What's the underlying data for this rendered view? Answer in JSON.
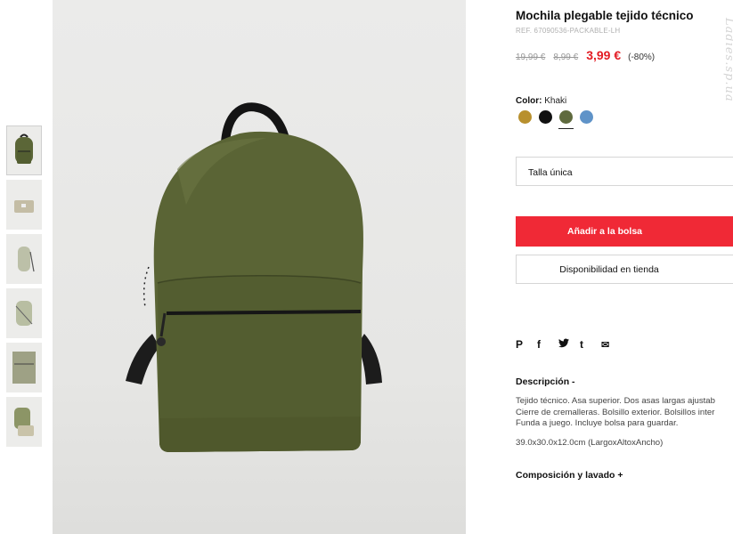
{
  "product": {
    "title": "Mochila plegable tejido técnico",
    "ref": "REF. 67090536-PACKABLE-LH",
    "old_price_1": "19,99 €",
    "old_price_2": "8,99 €",
    "price": "3,99 €",
    "discount": "(-80%)"
  },
  "color": {
    "label": "Color:",
    "value": "Khaki",
    "swatches": [
      {
        "name": "mustard",
        "hex": "#b8902e"
      },
      {
        "name": "black",
        "hex": "#111111"
      },
      {
        "name": "khaki",
        "hex": "#5f6a3e",
        "selected": true
      },
      {
        "name": "blue",
        "hex": "#5f93c8"
      }
    ]
  },
  "size": {
    "value": "Talla única"
  },
  "actions": {
    "add_to_bag": "Añadir a la bolsa",
    "store_availability": "Disponibilidad en tienda"
  },
  "share": {
    "pinterest": "P",
    "facebook": "f",
    "twitter": "t",
    "tumblr": "t",
    "email": "✉"
  },
  "description": {
    "title": "Descripción -",
    "line1": "Tejido técnico. Asa superior. Dos asas largas ajustab",
    "line2": "Cierre de cremalleras. Bolsillo exterior. Bolsillos inter",
    "line3": "Funda a juego. Incluye bolsa para guardar.",
    "dimensions": "39.0x30.0x12.0cm (LargoxAltoxAncho)"
  },
  "composition": {
    "title": "Composición y lavado +"
  },
  "watermark": "Ladies.sp.ua"
}
